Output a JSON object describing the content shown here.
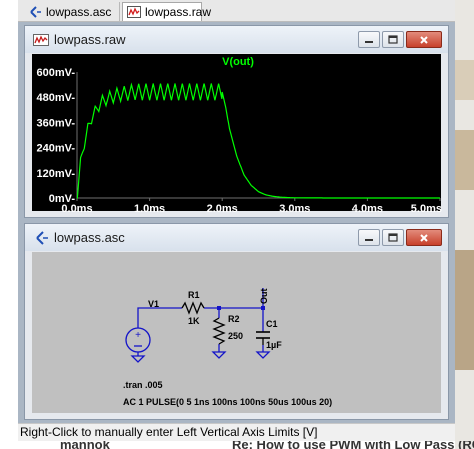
{
  "tabs": [
    {
      "label": "lowpass.asc",
      "icon": "schematic-icon"
    },
    {
      "label": "lowpass.raw",
      "icon": "waveform-icon"
    }
  ],
  "waveform_window": {
    "title": "lowpass.raw",
    "trace_label": "V(out)",
    "trace_color": "#00ff00",
    "y_ticks": [
      "0mV-",
      "120mV-",
      "240mV-",
      "360mV-",
      "480mV-",
      "600mV-"
    ],
    "x_ticks": [
      "0.0ms",
      "1.0ms",
      "2.0ms",
      "3.0ms",
      "4.0ms",
      "5.0ms"
    ]
  },
  "schematic_window": {
    "title": "lowpass.asc",
    "components": {
      "source": "V1",
      "resistor1_name": "R1",
      "resistor1_value": "1K",
      "resistor2_name": "R2",
      "resistor2_value": "250",
      "capacitor_name": "C1",
      "capacitor_value": "1µF",
      "output_label": "Out"
    },
    "directive_tran": ".tran .005",
    "source_spec": "AC 1  PULSE(0 5 1ns 100ns 100ns 50us 100us 20)"
  },
  "status_bar": "Right-Click to manually enter Left Vertical Axis Limits [V]",
  "background_page": {
    "left_text": "mannok",
    "right_text": "Re: How to use PWM with Low Pass (RC"
  },
  "chart_data": {
    "type": "line",
    "title": "",
    "xlabel": "",
    "ylabel": "",
    "xlim": [
      0,
      5
    ],
    "ylim": [
      0,
      600
    ],
    "x_unit": "ms",
    "y_unit": "mV",
    "grid": false,
    "series": [
      {
        "name": "V(out)",
        "color": "#00ff00",
        "x": [
          0,
          0.05,
          0.1,
          0.15,
          0.2,
          0.25,
          0.3,
          0.35,
          0.4,
          0.5,
          0.6,
          0.7,
          0.8,
          0.9,
          1.0,
          1.1,
          1.2,
          1.3,
          1.4,
          1.5,
          1.6,
          1.7,
          1.8,
          1.9,
          2.0,
          2.05,
          2.1,
          2.2,
          2.3,
          2.4,
          2.5,
          2.6,
          2.7,
          2.8,
          2.9,
          3.0,
          3.5,
          4.0,
          4.5,
          5.0
        ],
        "y": [
          0,
          170,
          260,
          330,
          380,
          410,
          440,
          460,
          470,
          485,
          495,
          500,
          505,
          505,
          505,
          505,
          505,
          505,
          505,
          505,
          505,
          505,
          505,
          505,
          505,
          430,
          330,
          200,
          110,
          60,
          30,
          15,
          8,
          4,
          2,
          1,
          0,
          0,
          0,
          0
        ]
      }
    ],
    "ripple_mV": 80
  }
}
